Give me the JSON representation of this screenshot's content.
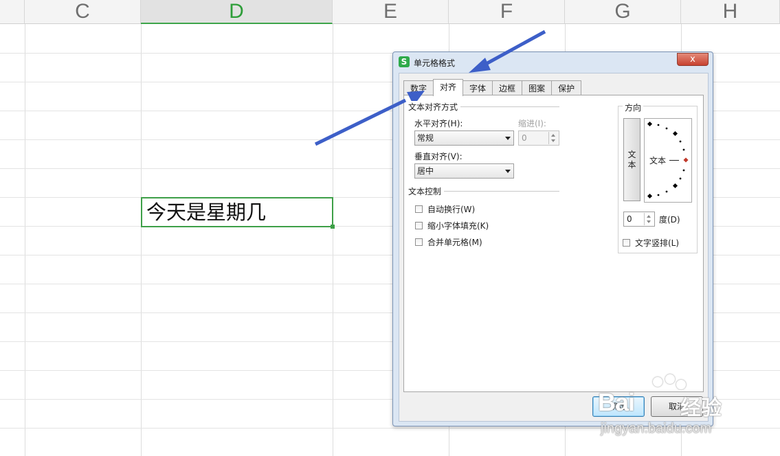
{
  "spreadsheet": {
    "columns": [
      "C",
      "D",
      "E",
      "F",
      "G",
      "H"
    ],
    "active_column": "D",
    "selected_cell_text": "今天是星期几"
  },
  "dialog": {
    "title": "单元格格式",
    "app_icon_letter": "S",
    "close_symbol": "x",
    "tabs": [
      "数字",
      "对齐",
      "字体",
      "边框",
      "图案",
      "保护"
    ],
    "active_tab": "对齐",
    "text_alignment": {
      "title": "文本对齐方式",
      "horizontal_label": "水平对齐(H):",
      "horizontal_value": "常规",
      "indent_label": "缩进(I):",
      "indent_value": "0",
      "vertical_label": "垂直对齐(V):",
      "vertical_value": "居中"
    },
    "text_control": {
      "title": "文本控制",
      "wrap_text": "自动换行(W)",
      "shrink_to_fit": "缩小字体填充(K)",
      "merge_cells": "合并单元格(M)"
    },
    "orientation": {
      "title": "方向",
      "vertical_text_button": "文本",
      "dial_text": "文本",
      "degrees_value": "0",
      "degrees_label": "度(D)",
      "vertical_layout_checkbox": "文字竖排(L)"
    },
    "buttons": {
      "ok": "确定",
      "cancel": "取消"
    }
  },
  "annotation_color": "#3d5fc8",
  "watermark": {
    "logo": "Bai",
    "brand": "经验",
    "url": "jingyan.baidu.com"
  }
}
